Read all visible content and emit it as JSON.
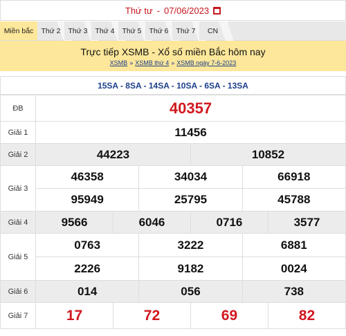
{
  "date_bar": {
    "day": "Thứ tư",
    "separator": "-",
    "date": "07/06/2023",
    "icon": "calendar-icon",
    "color": "#c5161d"
  },
  "tabs": [
    {
      "label": "Miền bắc",
      "active": true
    },
    {
      "label": "Thứ 2",
      "active": false
    },
    {
      "label": "Thứ 3",
      "active": false
    },
    {
      "label": "Thứ 4",
      "active": false
    },
    {
      "label": "Thứ 5",
      "active": false
    },
    {
      "label": "Thứ 6",
      "active": false
    },
    {
      "label": "Thứ 7",
      "active": false
    },
    {
      "label": "CN",
      "active": false
    }
  ],
  "banner": {
    "title": "Trực tiếp XSMB - Xổ số miền Bắc hôm nay",
    "breadcrumb": [
      "XSMB",
      "XSMB thứ 4",
      "XSMB ngày 7-6-2023"
    ],
    "arrow": "»"
  },
  "codes": "15SA - 8SA - 14SA - 10SA - 6SA - 13SA",
  "prizes": {
    "db": {
      "label": "ĐB",
      "numbers": [
        "40357"
      ]
    },
    "g1": {
      "label": "Giải 1",
      "numbers": [
        "11456"
      ]
    },
    "g2": {
      "label": "Giải 2",
      "numbers": [
        "44223",
        "10852"
      ]
    },
    "g3": {
      "label": "Giải 3",
      "numbers": [
        "46358",
        "34034",
        "66918",
        "95949",
        "25795",
        "45788"
      ]
    },
    "g4": {
      "label": "Giải 4",
      "numbers": [
        "9566",
        "6046",
        "0716",
        "3577"
      ]
    },
    "g5": {
      "label": "Giải 5",
      "numbers": [
        "0763",
        "3222",
        "6881",
        "2226",
        "9182",
        "0024"
      ]
    },
    "g6": {
      "label": "Giải 6",
      "numbers": [
        "014",
        "056",
        "738"
      ]
    },
    "g7": {
      "label": "Giải 7",
      "numbers": [
        "17",
        "72",
        "69",
        "82"
      ]
    }
  },
  "colors": {
    "accent_red": "#d1181f",
    "banner_yellow": "#fde79a",
    "link_blue": "#1b3e8a",
    "row_shade": "#ececec"
  }
}
